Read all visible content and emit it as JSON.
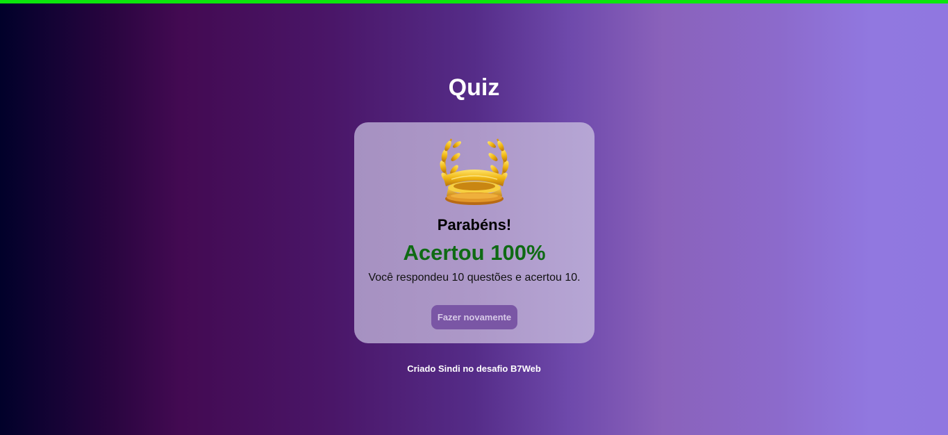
{
  "progress": {
    "fraction": 1.0,
    "color": "#0ce60c"
  },
  "header": {
    "title": "Quiz"
  },
  "result": {
    "trophy_icon": "laurel-trophy-icon",
    "congrats": "Parabéns!",
    "score": "Acertou 100%",
    "score_percent": 100,
    "score_color": "#0f6a14",
    "description": "Você respondeu 10 questões e acertou 10.",
    "retry_label": "Fazer novamente"
  },
  "footer": {
    "credit": "Criado Sindi no desafio B7Web"
  }
}
